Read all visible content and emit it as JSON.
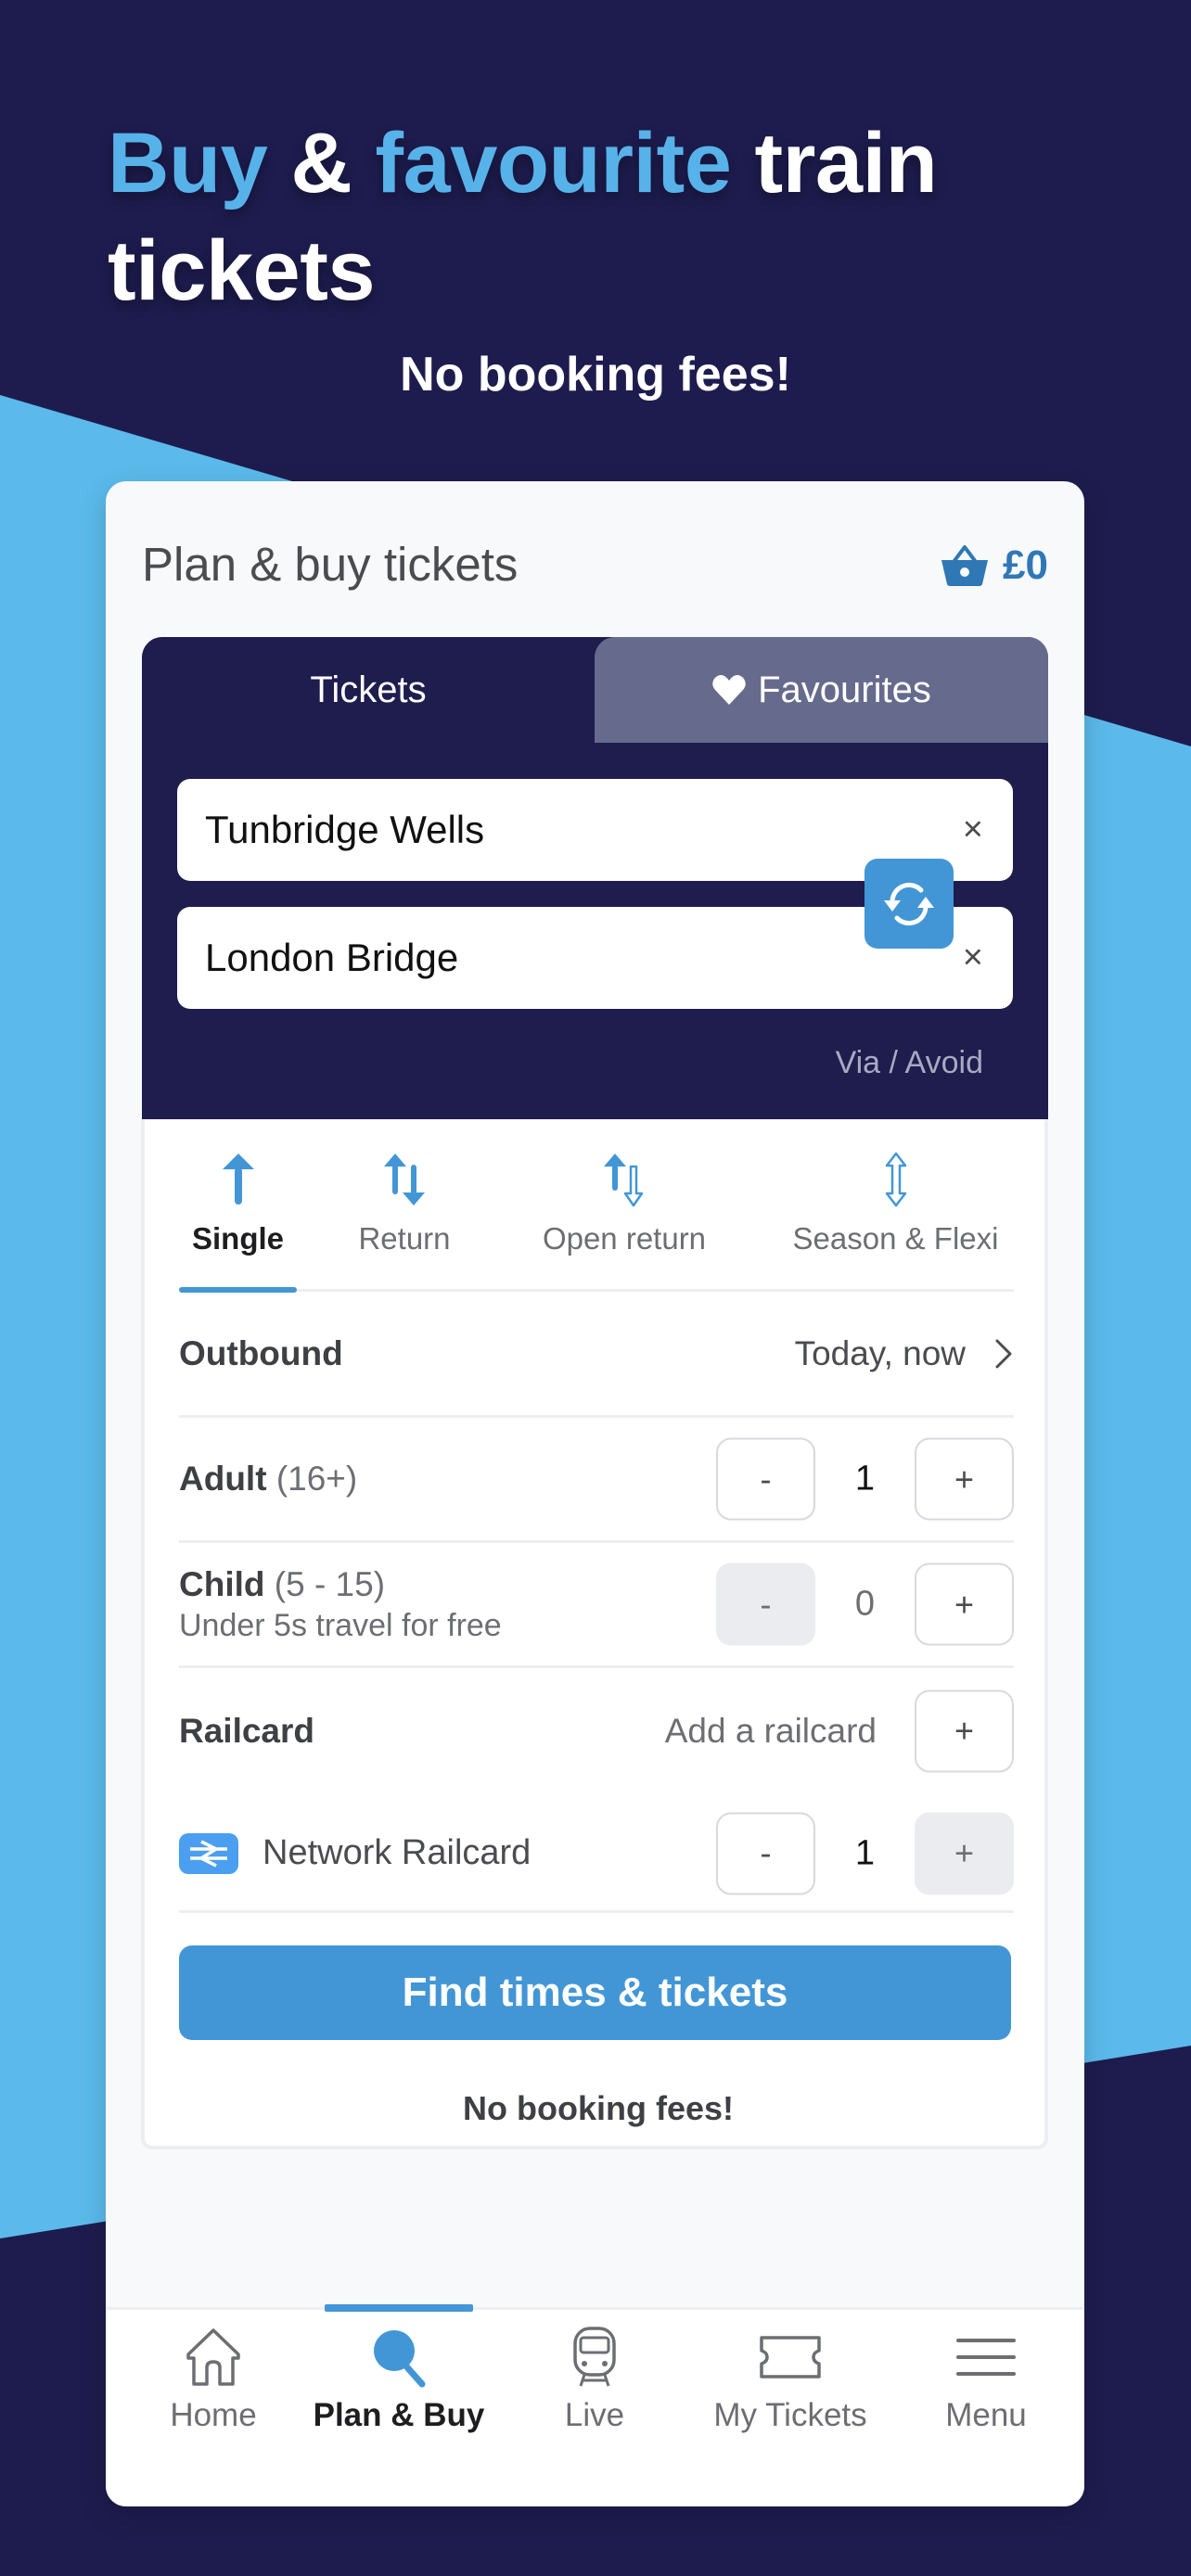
{
  "promo": {
    "headline_part1": "Buy",
    "headline_amp": "&",
    "headline_part2": "favourite",
    "headline_part3": "train",
    "headline_line2": "tickets",
    "subheadline": "No booking fees!"
  },
  "colors": {
    "background_dark": "#1e1c4e",
    "band_light_blue": "#5bbaeb",
    "accent_blue": "#4396d6",
    "basket_blue": "#2f78b5",
    "favourites_tab": "#666a8c"
  },
  "header": {
    "title": "Plan & buy tickets",
    "basket_icon": "basket-icon",
    "basket_total": "£0"
  },
  "tabs": [
    {
      "label": "Tickets",
      "active": true
    },
    {
      "label": "Favourites",
      "icon": "heart-icon",
      "active": false
    }
  ],
  "journey": {
    "from": {
      "value": "Tunbridge Wells",
      "clear_label": "×"
    },
    "to": {
      "value": "London Bridge",
      "clear_label": "×"
    },
    "swap_icon": "swap-icon",
    "via_avoid": "Via / Avoid"
  },
  "ticket_types": [
    {
      "label": "Single",
      "icon": "single-arrow-icon",
      "active": true
    },
    {
      "label": "Return",
      "icon": "return-arrows-icon",
      "active": false
    },
    {
      "label": "Open return",
      "icon": "open-return-arrows-icon",
      "active": false
    },
    {
      "label": "Season & Flexi",
      "icon": "season-flexi-arrow-icon",
      "active": false
    }
  ],
  "outbound": {
    "label": "Outbound",
    "value": "Today, now"
  },
  "passengers": {
    "adult": {
      "label": "Adult",
      "age": "(16+)",
      "count": "1",
      "minus": "-",
      "plus": "+"
    },
    "child": {
      "label": "Child",
      "age": "(5 - 15)",
      "note": "Under 5s travel for free",
      "count": "0",
      "minus": "-",
      "plus": "+"
    }
  },
  "railcard": {
    "label": "Railcard",
    "add_text": "Add a railcard",
    "add_button": "+",
    "items": [
      {
        "name": "Network Railcard",
        "count": "1",
        "minus": "-",
        "plus": "+"
      }
    ]
  },
  "find_button": "Find times & tickets",
  "footer_note": "No booking fees!",
  "bottom_nav": [
    {
      "label": "Home",
      "icon": "home-icon",
      "active": false
    },
    {
      "label": "Plan & Buy",
      "icon": "search-icon",
      "active": true
    },
    {
      "label": "Live",
      "icon": "train-icon",
      "active": false
    },
    {
      "label": "My Tickets",
      "icon": "ticket-icon",
      "active": false
    },
    {
      "label": "Menu",
      "icon": "menu-icon",
      "active": false
    }
  ]
}
